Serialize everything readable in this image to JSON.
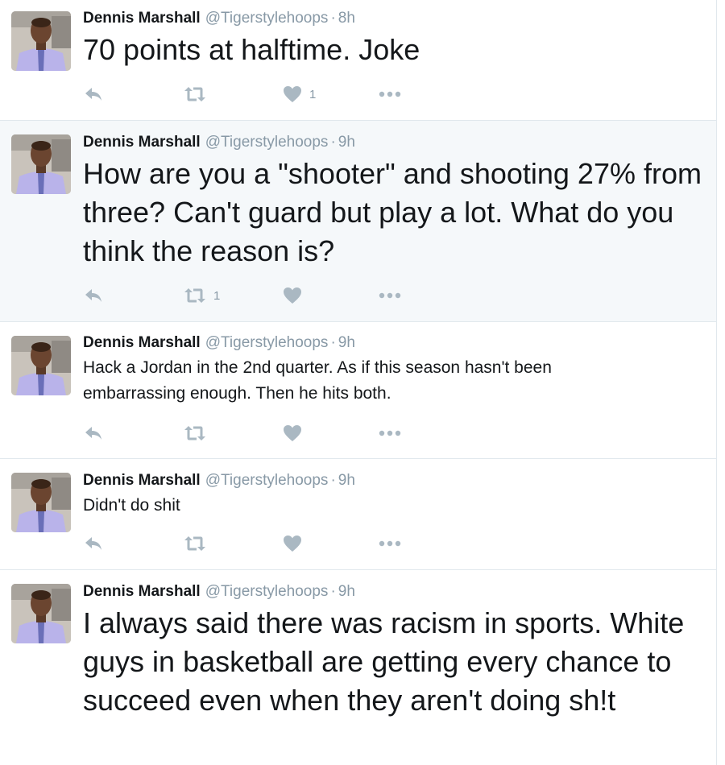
{
  "colors": {
    "name": "#14171a",
    "meta": "#8899a6",
    "action_icon": "#aab8c2",
    "highlight_bg": "#f5f8fa",
    "divider": "#e1e8ed"
  },
  "tweets": [
    {
      "name": "Dennis Marshall",
      "handle": "@Tigerstylehoops",
      "separator": "·",
      "time": "8h",
      "text": "70 points at halftime. Joke",
      "reply_icon": "reply-icon",
      "retweet_icon": "retweet-icon",
      "like_icon": "heart-icon",
      "more_icon": "more-icon",
      "retweet_count": "",
      "like_count": "1"
    },
    {
      "name": "Dennis Marshall",
      "handle": "@Tigerstylehoops",
      "separator": "·",
      "time": "9h",
      "text": "How are you a \"shooter\" and shooting 27% from three? Can't guard but play a lot. What do you think the reason is?",
      "retweet_count": "1",
      "like_count": ""
    },
    {
      "name": "Dennis Marshall",
      "handle": "@Tigerstylehoops",
      "separator": "·",
      "time": "9h",
      "text": "Hack a Jordan in the 2nd quarter. As if this season hasn't been embarrassing enough. Then he hits both.",
      "retweet_count": "",
      "like_count": ""
    },
    {
      "name": "Dennis Marshall",
      "handle": "@Tigerstylehoops",
      "separator": "·",
      "time": "9h",
      "text": "Didn't do shit",
      "retweet_count": "",
      "like_count": ""
    },
    {
      "name": "Dennis Marshall",
      "handle": "@Tigerstylehoops",
      "separator": "·",
      "time": "9h",
      "text": "I always said there was racism in sports. White guys in basketball are getting every chance to succeed even when they aren't doing sh!t",
      "retweet_count": "",
      "like_count": ""
    }
  ]
}
